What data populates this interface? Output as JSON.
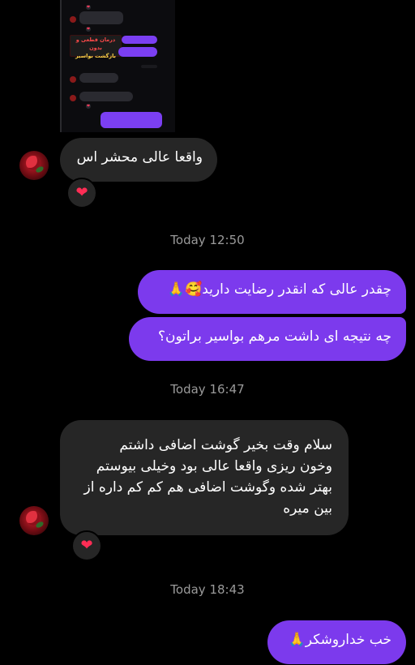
{
  "thumbnail": {
    "promo_line1": "درمان قطعی و بدون",
    "promo_line2": "بازگشت بواسیر"
  },
  "messages": {
    "m1": "واقعا عالی محشر اس",
    "m2": "چقدر عالی که انقدر رضایت دارید🥰🙏",
    "m3": "چه نتیجه ای داشت مرهم بواسیر براتون؟",
    "m4_line1": "سلام وقت بخیر گوشت اضافی داشتم",
    "m4_line2": "وخون ریزی واقعا عالی بود وخیلی بیوستم",
    "m4_line3": "بهتر شده وگوشت اضافی هم کم کم داره از",
    "m4_line4": "بین میره",
    "m5": "خب خداروشکر🙏"
  },
  "timestamps": {
    "t1": "Today 12:50",
    "t2": "Today 16:47",
    "t3": "Today 18:43"
  },
  "reactions": {
    "emoji": "❤"
  },
  "colors": {
    "sent_bubble": "#7c3aed",
    "received_bubble": "#262626",
    "background": "#000000",
    "heart": "#ff2d55"
  }
}
